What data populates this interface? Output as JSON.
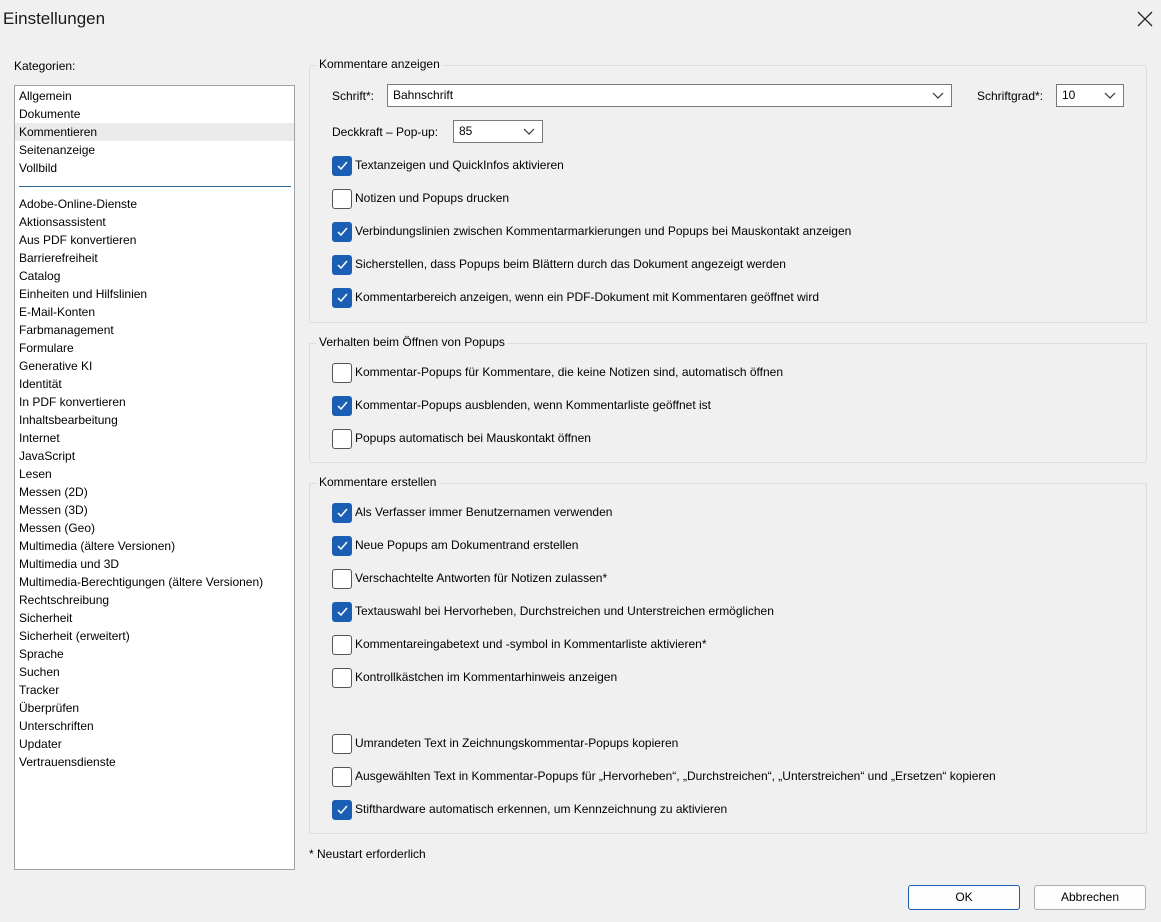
{
  "window": {
    "title": "Einstellungen"
  },
  "sidebar": {
    "label": "Kategorien:",
    "top_items": [
      "Allgemein",
      "Dokumente",
      "Kommentieren",
      "Seitenanzeige",
      "Vollbild"
    ],
    "items": [
      "Adobe-Online-Dienste",
      "Aktionsassistent",
      "Aus PDF konvertieren",
      "Barrierefreiheit",
      "Catalog",
      "Einheiten und Hilfslinien",
      "E-Mail-Konten",
      "Farbmanagement",
      "Formulare",
      "Generative KI",
      "Identität",
      "In PDF konvertieren",
      "Inhaltsbearbeitung",
      "Internet",
      "JavaScript",
      "Lesen",
      "Messen (2D)",
      "Messen (3D)",
      "Messen (Geo)",
      "Multimedia (ältere Versionen)",
      "Multimedia und 3D",
      "Multimedia-Berechtigungen (ältere Versionen)",
      "Rechtschreibung",
      "Sicherheit",
      "Sicherheit (erweitert)",
      "Sprache",
      "Suchen",
      "Tracker",
      "Überprüfen",
      "Unterschriften",
      "Updater",
      "Vertrauensdienste"
    ],
    "selected": "Kommentieren"
  },
  "display": {
    "title": "Kommentare anzeigen",
    "font_label": "Schrift*:",
    "font_value": "Bahnschrift",
    "size_label": "Schriftgrad*:",
    "size_value": "10",
    "opacity_label": "Deckkraft – Pop-up:",
    "opacity_value": "85",
    "options": [
      {
        "label": "Textanzeigen und QuickInfos aktivieren",
        "checked": true
      },
      {
        "label": "Notizen und Popups drucken",
        "checked": false
      },
      {
        "label": "Verbindungslinien zwischen Kommentarmarkierungen und Popups bei Mauskontakt anzeigen",
        "checked": true
      },
      {
        "label": "Sicherstellen, dass Popups beim Blättern durch das Dokument angezeigt werden",
        "checked": true
      },
      {
        "label": "Kommentarbereich anzeigen, wenn ein PDF-Dokument mit Kommentaren geöffnet wird",
        "checked": true
      }
    ]
  },
  "popup_behavior": {
    "title": "Verhalten beim Öffnen von Popups",
    "options": [
      {
        "label": "Kommentar-Popups für Kommentare, die keine Notizen sind, automatisch öffnen",
        "checked": false
      },
      {
        "label": "Kommentar-Popups ausblenden, wenn Kommentarliste geöffnet ist",
        "checked": true
      },
      {
        "label": "Popups automatisch bei Mauskontakt öffnen",
        "checked": false
      }
    ]
  },
  "create": {
    "title": "Kommentare erstellen",
    "options": [
      {
        "label": "Als Verfasser immer Benutzernamen verwenden",
        "checked": true
      },
      {
        "label": "Neue Popups am Dokumentrand erstellen",
        "checked": true
      },
      {
        "label": "Verschachtelte Antworten für Notizen zulassen*",
        "checked": false
      },
      {
        "label": "Textauswahl bei Hervorheben, Durchstreichen und Unterstreichen ermöglichen",
        "checked": true
      },
      {
        "label": "Kommentareingabetext und -symbol in Kommentarliste aktivieren*",
        "checked": false
      },
      {
        "label": "Kontrollkästchen im Kommentarhinweis anzeigen",
        "checked": false
      },
      {
        "label": "Umrandeten Text in Zeichnungskommentar-Popups kopieren",
        "checked": false
      },
      {
        "label": "Ausgewählten Text in Kommentar-Popups für „Hervorheben“, „Durchstreichen“, „Unterstreichen“ und „Ersetzen“ kopieren",
        "checked": false
      },
      {
        "label": "Stifthardware automatisch erkennen, um Kennzeichnung zu aktivieren",
        "checked": true
      }
    ]
  },
  "footer": {
    "note": "* Neustart erforderlich",
    "ok_label": "OK",
    "cancel_label": "Abbrechen"
  },
  "colors": {
    "checked_fill": "#1a5fb4",
    "accent_border": "#1a5fb4"
  }
}
